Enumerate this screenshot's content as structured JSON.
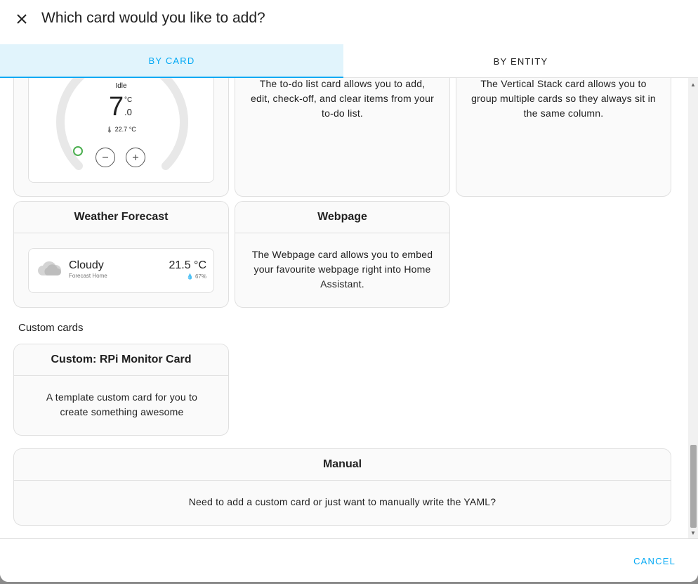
{
  "dialog": {
    "title": "Which card would you like to add?",
    "close_icon": "close-icon"
  },
  "tabs": [
    {
      "label": "BY CARD",
      "active": true
    },
    {
      "label": "BY ENTITY",
      "active": false
    }
  ],
  "cards": {
    "thermostat": {
      "state": "Idle",
      "temp_int": "7",
      "temp_unit": "°C",
      "temp_dec": ".0",
      "current": "22.7 °C"
    },
    "todo": {
      "description": "The to-do list card allows you to add, edit, check-off, and clear items from your to-do list."
    },
    "vertical_stack": {
      "description": "The Vertical Stack card allows you to group multiple cards so they always sit in the same column."
    },
    "weather": {
      "title": "Weather Forecast",
      "condition": "Cloudy",
      "location": "Forecast Home",
      "temperature": "21.5 °C",
      "humidity": "67%"
    },
    "webpage": {
      "title": "Webpage",
      "description": "The Webpage card allows you to embed your favourite webpage right into Home Assistant."
    }
  },
  "custom_section": {
    "label": "Custom cards",
    "rpi": {
      "title": "Custom: RPi Monitor Card",
      "description": "A template custom card for you to create something awesome"
    }
  },
  "manual": {
    "title": "Manual",
    "description": "Need to add a custom card or just want to manually write the YAML?"
  },
  "footer": {
    "cancel_label": "CANCEL"
  },
  "colors": {
    "accent": "#03a9f4",
    "active_tab_bg": "#e1f4fc",
    "thermostat_ring": "#e8e8e8",
    "idle_dot": "#4caf50"
  }
}
